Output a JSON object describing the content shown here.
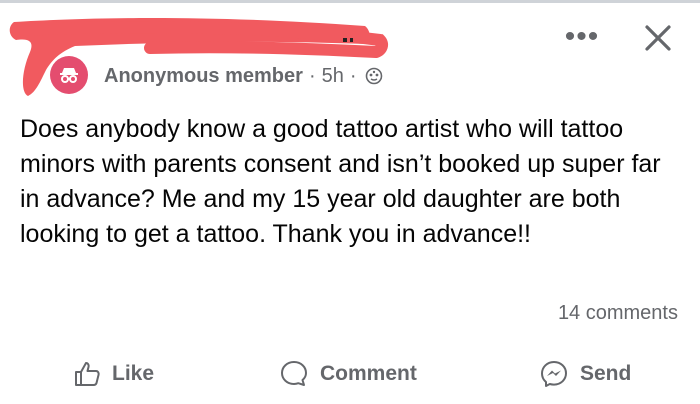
{
  "post": {
    "author": "Anonymous member",
    "separator": "·",
    "time": "5h",
    "audience_icon": "globe-icon",
    "text": "Does anybody know a good tattoo artist who will tattoo minors with parents consent and isn’t booked up super far in advance? Me and my 15 year old daughter are both looking to get a tattoo. Thank you in advance!!",
    "comments_count": "14 comments"
  },
  "header": {
    "more_icon": "•••",
    "close_icon": "close-icon"
  },
  "actions": {
    "like_label": "Like",
    "comment_label": "Comment",
    "send_label": "Send"
  },
  "colors": {
    "redaction": "#f15a5f",
    "avatar": "#e44d6f",
    "secondary_text": "#65676b",
    "primary_text": "#050505"
  }
}
